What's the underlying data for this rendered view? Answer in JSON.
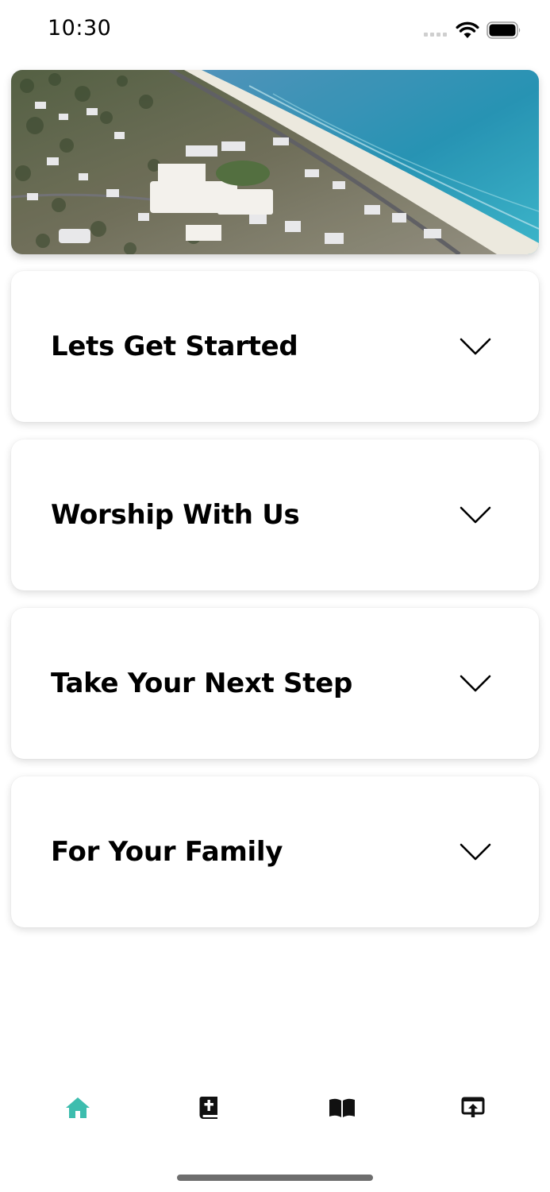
{
  "status_bar": {
    "time": "10:30"
  },
  "hero": {
    "icon": "coastal-town-aerial-image"
  },
  "sections": [
    {
      "label": "Lets Get Started"
    },
    {
      "label": "Worship With Us"
    },
    {
      "label": "Take Your Next Step"
    },
    {
      "label": "For Your Family"
    }
  ],
  "tab_bar": {
    "active_color": "#3dbdae",
    "inactive_color": "#111111",
    "tabs": [
      {
        "icon": "home-icon",
        "active": true
      },
      {
        "icon": "bible-icon",
        "active": false
      },
      {
        "icon": "open-book-icon",
        "active": false
      },
      {
        "icon": "share-screen-icon",
        "active": false
      }
    ]
  }
}
